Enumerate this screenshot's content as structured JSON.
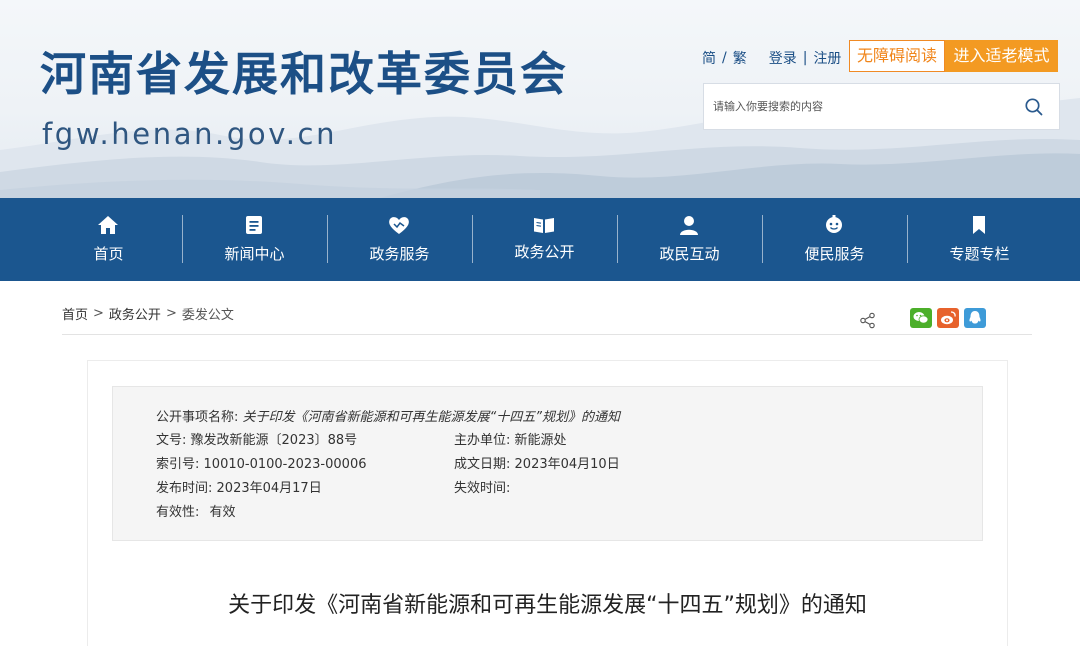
{
  "header": {
    "title": "河南省发展和改革委员会",
    "domain": "fgw.henan.gov.cn",
    "links": {
      "simplified": "简",
      "slash": "/",
      "traditional": "繁",
      "login": "登录",
      "bar": "|",
      "register": "注册"
    },
    "accessible_label": "无障碍阅读",
    "elder_mode_label": "进入适老模式",
    "search_placeholder": "请输入你要搜索的内容",
    "accent_color": "#f39a22",
    "brand_color": "#1c4f86"
  },
  "nav": {
    "background": "#1b568f",
    "items": [
      {
        "label": "首页",
        "icon": "home-icon"
      },
      {
        "label": "新闻中心",
        "icon": "news-icon"
      },
      {
        "label": "政务服务",
        "icon": "handshake-heart-icon"
      },
      {
        "label": "政务公开",
        "icon": "book-icon"
      },
      {
        "label": "政民互动",
        "icon": "user-icon"
      },
      {
        "label": "便民服务",
        "icon": "service-icon"
      },
      {
        "label": "专题专栏",
        "icon": "bookmark-icon"
      }
    ]
  },
  "breadcrumb": {
    "items": [
      "首页",
      "政务公开",
      "委发公文"
    ],
    "separator": ">"
  },
  "share": {
    "icons": [
      "share-icon",
      "wechat-icon",
      "weibo-icon",
      "qq-icon"
    ]
  },
  "meta": {
    "item_name_label": "公开事项名称:",
    "item_name_value": "关于印发《河南省新能源和可再生能源发展“十四五”规划》的通知",
    "doc_no_label": "文号:",
    "doc_no_value": "豫发改新能源〔2023〕88号",
    "host_unit_label": "主办单位:",
    "host_unit_value": "新能源处",
    "index_no_label": "索引号:",
    "index_no_value": "10010-0100-2023-00006",
    "created_date_label": "成文日期:",
    "created_date_value": "2023年04月10日",
    "publish_time_label": "发布时间:",
    "publish_time_value": "2023年04月17日",
    "expire_time_label": "失效时间:",
    "expire_time_value": "",
    "validity_label": "有效性:",
    "validity_value": "有效"
  },
  "article": {
    "title": "关于印发《河南省新能源和可再生能源发展“十四五”规划》的通知"
  }
}
